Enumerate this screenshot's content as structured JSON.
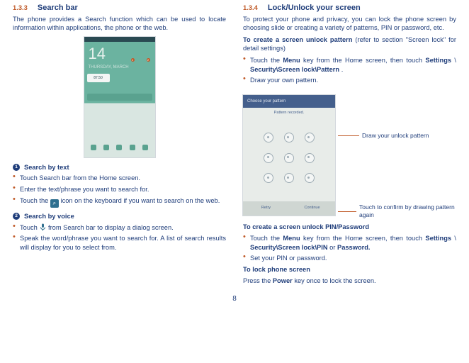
{
  "left": {
    "section_number": "1.3.3",
    "section_title": "Search bar",
    "intro": "The phone provides a Search function which can be used to locate information within applications, the phone or the web.",
    "home_shot": {
      "time": "14",
      "date_line": "THURSDAY, MARCH",
      "badge1": "1",
      "badge2": "2",
      "temp": "87.50"
    },
    "sub1_num": "1",
    "sub1_title": "Search by text",
    "sub1_items": [
      "Touch Search bar from the Home screen.",
      "Enter the text/phrase you want to search for.",
      "Touch the "
    ],
    "sub1_item3_tail": " icon on the keyboard if you want to search on the web.",
    "search_glyph": "⌕",
    "sub2_num": "2",
    "sub2_title": "Search by voice",
    "sub2_item1_head": "Touch ",
    "sub2_item1_tail": " from Search bar to display a dialog screen.",
    "mic_glyph": "🎤",
    "sub2_item2": "Speak the word/phrase you want to search for.  A list of search results will display for you to select from."
  },
  "right": {
    "section_number": "1.3.4",
    "section_title": "Lock/Unlock your screen",
    "intro": "To protect your phone and privacy, you can lock the phone screen by choosing slide or creating a variety of patterns, PIN or password, etc.",
    "h1_head": "To create a screen unlock pattern ",
    "h1_tail": "(refer to section \"Screen lock\" for detail settings)",
    "p1a": "Touch the ",
    "p1_menu": "Menu",
    "p1b": " key from the Home screen, then touch ",
    "p1_settings": "Settings",
    "p1c": "\\",
    "p1_path": "Security\\Screen lock\\Pattern",
    "p1d": ".",
    "p2": "Draw your own pattern.",
    "shot": {
      "topbar_text": "Choose your pattern",
      "msg": "Pattern recorded.",
      "btn_retry": "Retry",
      "btn_continue": "Continue"
    },
    "anno1": "Draw your unlock pattern",
    "anno2": "Touch to confirm by drawing pattern again",
    "h2": "To create a screen unlock PIN/Password",
    "p3a": "Touch the ",
    "p3_menu": "Menu",
    "p3b": " key from the Home screen, then touch ",
    "p3_settings": "Settings",
    "p3c": "\\",
    "p3_path": "Security\\Screen lock\\PIN ",
    "p3_or": "or ",
    "p3_pw": "Password.",
    "p4": "Set your PIN or password.",
    "h3": "To lock phone screen",
    "p5a": "Press the ",
    "p5_power": "Power",
    "p5b": " key once to lock the screen."
  },
  "page_number": "8"
}
